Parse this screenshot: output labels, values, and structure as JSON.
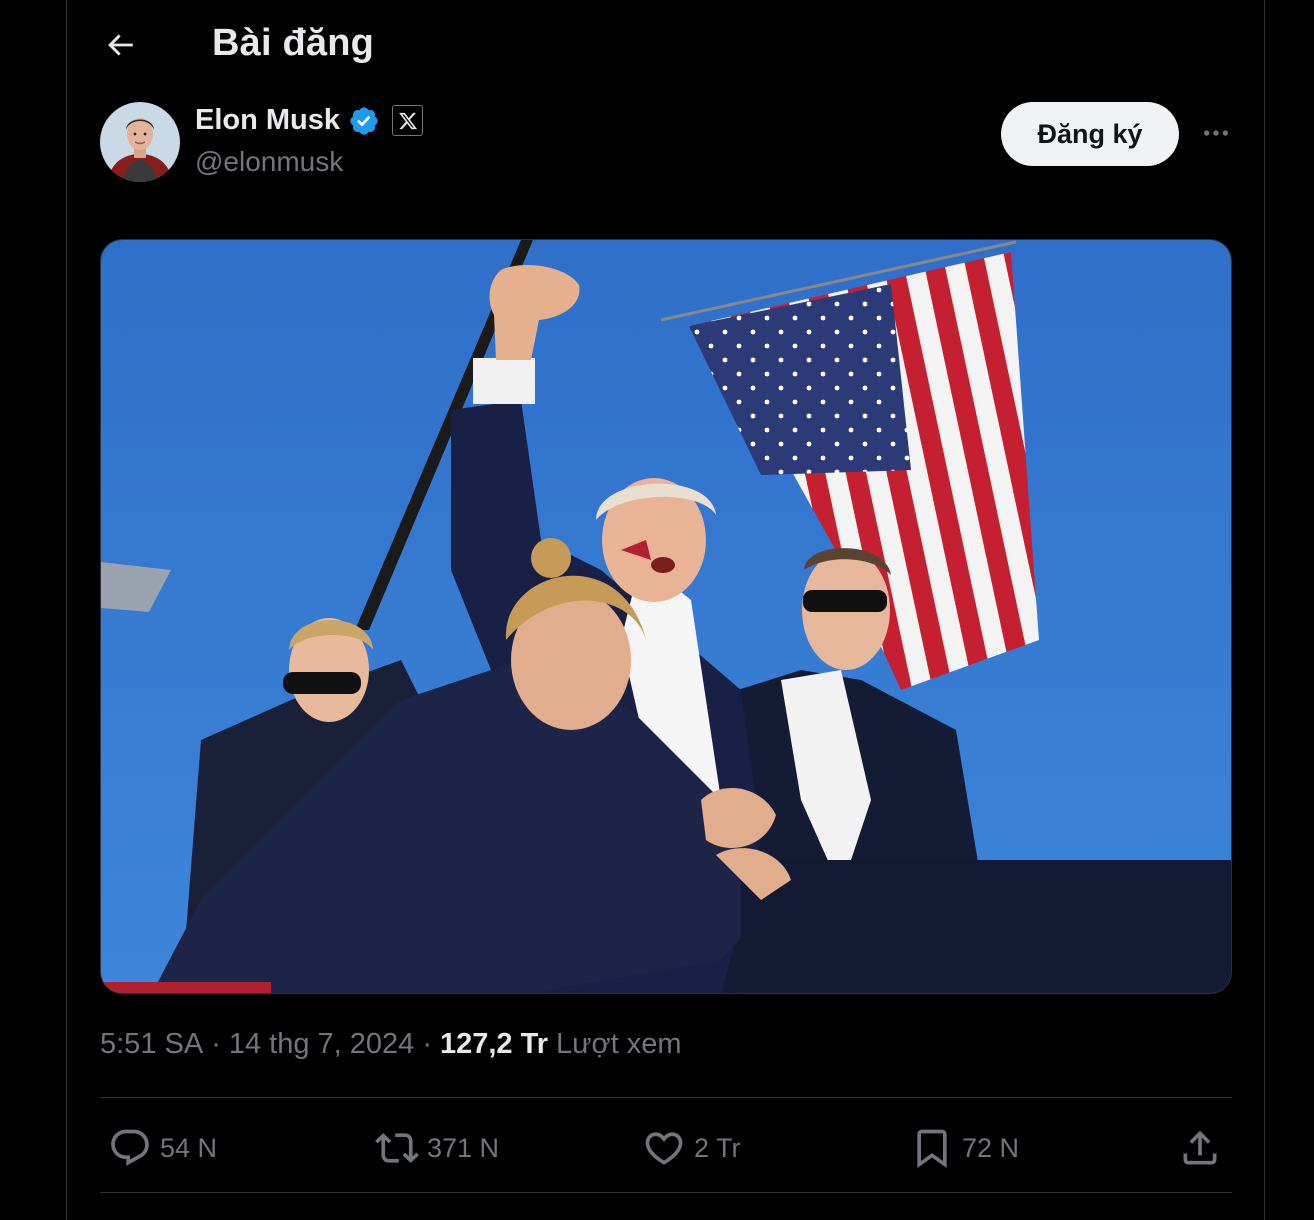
{
  "header": {
    "title": "Bài đăng",
    "back_icon": "arrow-left-icon"
  },
  "author": {
    "display_name": "Elon Musk",
    "handle": "@elonmusk",
    "verified_color": "#1d9bf0",
    "affiliate_badge": "X"
  },
  "actions_top": {
    "subscribe_label": "Đăng ký",
    "more_icon": "ellipsis-icon"
  },
  "post": {
    "time": "5:51 SA",
    "date": "14 thg 7, 2024",
    "separator": "·",
    "views_count": "127,2 Tr",
    "views_label": "Lượt xem"
  },
  "engagement": {
    "replies": "54 N",
    "reposts": "371 N",
    "likes": "2 Tr",
    "bookmarks": "72 N"
  },
  "colors": {
    "background": "#000000",
    "text_primary": "#e7e9ea",
    "text_secondary": "#71767b",
    "border": "#2f3336",
    "button_bg": "#eff3f4"
  }
}
